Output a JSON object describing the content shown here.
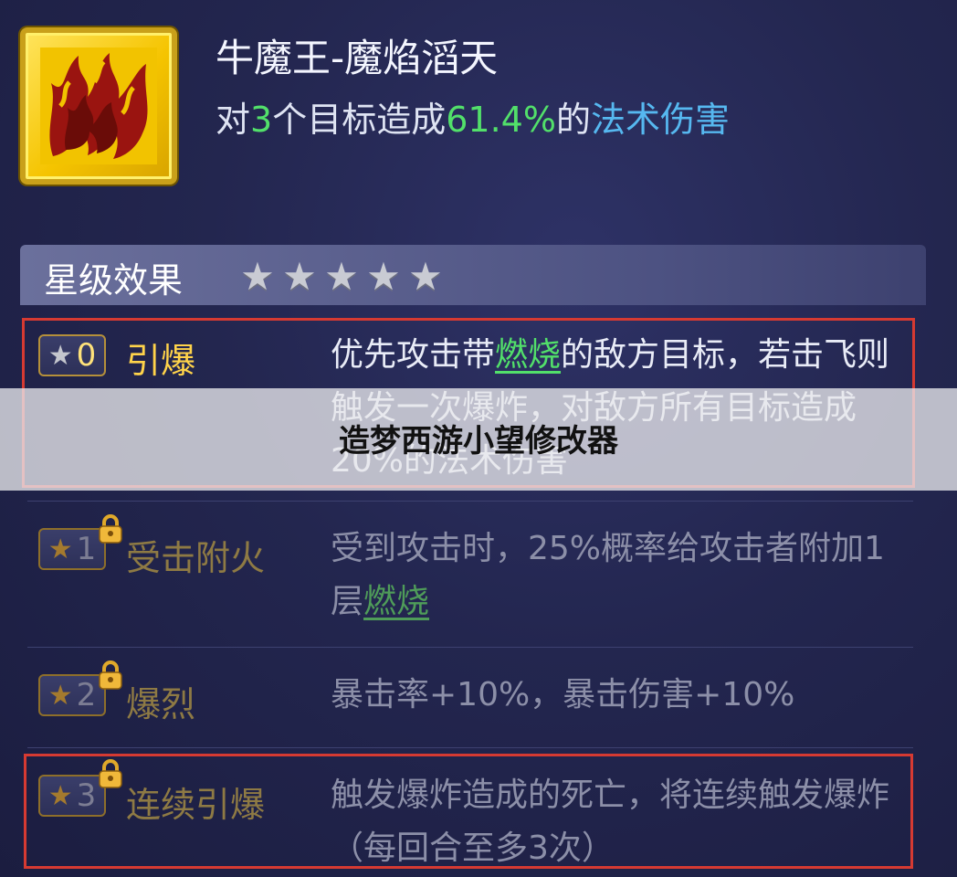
{
  "skill": {
    "icon": "flame-icon",
    "title": "牛魔王-魔焰滔天",
    "desc_prefix": "对",
    "target_count": "3",
    "desc_mid": "个目标造成",
    "damage_percent": "61.4%",
    "desc_mid2": "的",
    "damage_type": "法术伤害"
  },
  "star_panel": {
    "label": "星级效果",
    "stars": [
      "★",
      "★",
      "★",
      "★",
      "★"
    ]
  },
  "effects": [
    {
      "level": "0",
      "name": "引爆",
      "locked": false,
      "text_pre": "优先攻击带",
      "keyword": "燃烧",
      "text_post": "的敌方目标，若击飞则触发一次爆炸，对敌方所有目标造成20%的法术伤害"
    },
    {
      "level": "1",
      "name": "受击附火",
      "locked": true,
      "text_pre": "受到攻击时，25%概率给攻击者附加1层",
      "keyword": "燃烧",
      "text_post": ""
    },
    {
      "level": "2",
      "name": "爆烈",
      "locked": true,
      "text_pre": "暴击率+10%，暴击伤害+10%",
      "keyword": "",
      "text_post": ""
    },
    {
      "level": "3",
      "name": "连续引爆",
      "locked": true,
      "text_pre": "触发爆炸造成的死亡，将连续触发爆炸（每回合至多3次）",
      "keyword": "",
      "text_post": ""
    }
  ],
  "colors": {
    "highlight_green": "#52e06a",
    "highlight_blue": "#56b8f0",
    "frame_red": "#d63a32",
    "name_gold": "#ffd34a"
  },
  "watermark": "造梦西游小望修改器"
}
